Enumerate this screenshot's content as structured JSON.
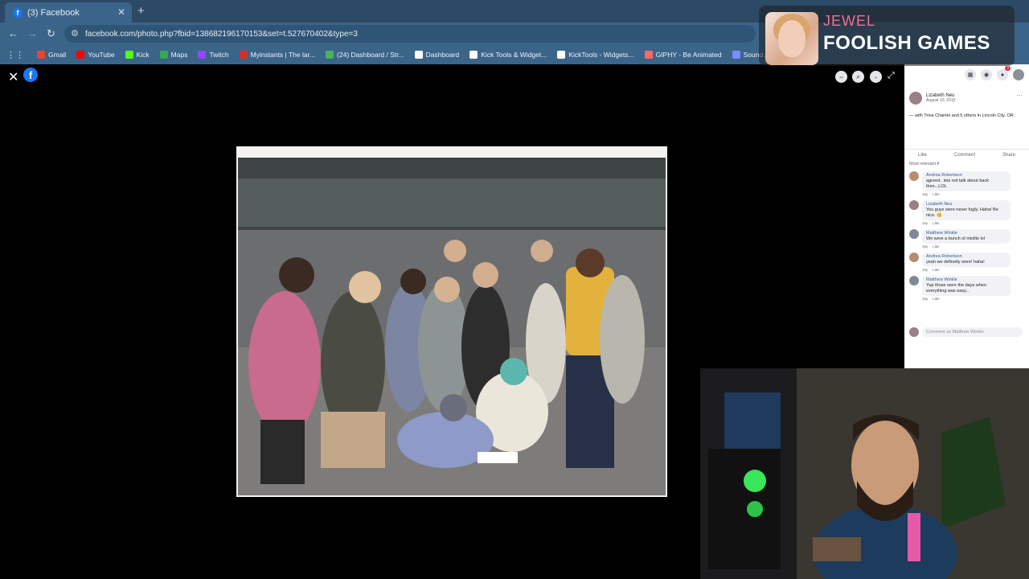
{
  "browser": {
    "tab_title": "(3) Facebook",
    "url": "facebook.com/photo.php?fbid=138682196170153&set=t.527670402&type=3",
    "bookmarks": [
      {
        "label": "Gmail",
        "color": "#ea4335"
      },
      {
        "label": "YouTube",
        "color": "#ff0000"
      },
      {
        "label": "Kick",
        "color": "#53fc18"
      },
      {
        "label": "Maps",
        "color": "#34a853"
      },
      {
        "label": "Twitch",
        "color": "#9146ff"
      },
      {
        "label": "Myinstants | The lar...",
        "color": "#d0312d"
      },
      {
        "label": "(24) Dashboard / Str...",
        "color": "#46b35d"
      },
      {
        "label": "Dashboard",
        "color": "#ffffff"
      },
      {
        "label": "Kick Tools & Widget...",
        "color": "#ffffff"
      },
      {
        "label": "KickTools - Widgets...",
        "color": "#ffffff"
      },
      {
        "label": "GIPHY - Be Animated",
        "color": "#ff6666"
      },
      {
        "label": "Sound Alerts Dashb...",
        "color": "#7c8cff"
      }
    ]
  },
  "viewer": {
    "photo_alt": "Group photo of teenagers"
  },
  "post": {
    "author": "Lizabeth Neu",
    "date": "August 10, 2010",
    "caption": "— with Trina Chantel and 5 others in Lincoln City, OR.",
    "actions": {
      "like": "Like",
      "comment": "Comment",
      "share": "Share"
    },
    "sort_label": "Most relevant",
    "comments": [
      {
        "name": "Andrea Robertson",
        "text": "agreed.. lets not talk about back then...LOL",
        "meta_time": "15y",
        "meta_like": "Like"
      },
      {
        "name": "Lizabeth Neu",
        "text": "You guys were never fugly. Haha! Be nice. 😊",
        "meta_time": "15y",
        "meta_like": "Like"
      },
      {
        "name": "Matthew Winkle",
        "text": "We were a bunch of misfits lol",
        "meta_time": "15y",
        "meta_like": "Like"
      },
      {
        "name": "Andrea Robertson",
        "text": "yeah we definetly were! haha!",
        "meta_time": "15y",
        "meta_like": "Like"
      },
      {
        "name": "Matthew Winkle",
        "text": "Yup those were the days when everything was easy...",
        "meta_time": "15y",
        "meta_like": "Like"
      }
    ],
    "comment_placeholder": "Comment as Matthew Winkle",
    "notification_count": "3"
  },
  "now_playing": {
    "artist": "JEWEL",
    "song": "FOOLISH GAMES"
  }
}
